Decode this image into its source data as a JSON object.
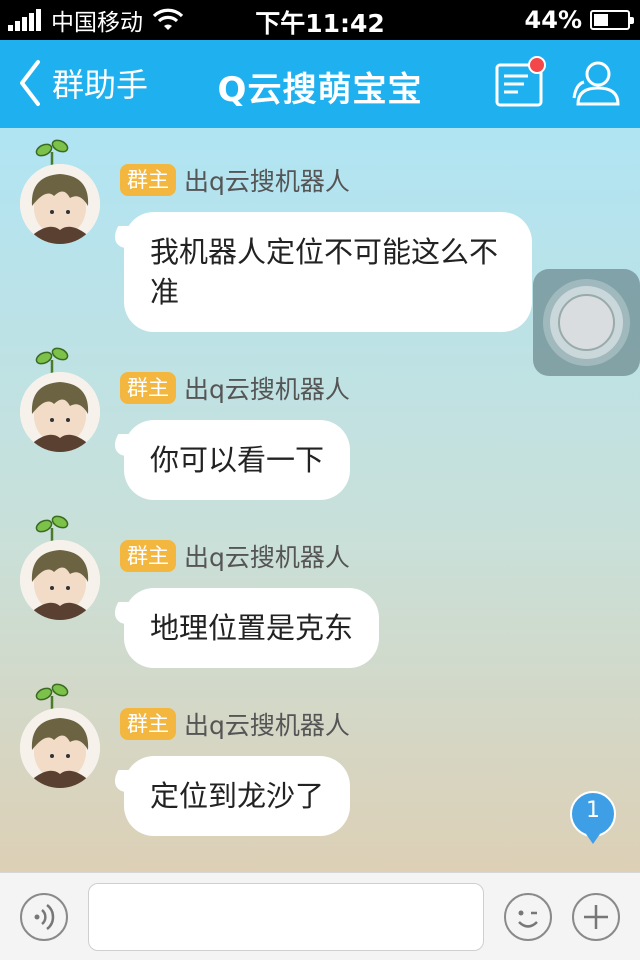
{
  "status_bar": {
    "carrier": "中国移动",
    "time": "下午11:42",
    "battery_text": "44%",
    "battery_level": 0.44,
    "signal_bars": 5
  },
  "nav": {
    "back_label": "群助手",
    "title": "Q云搜萌宝宝",
    "accent_color": "#1fb0ef"
  },
  "messages": [
    {
      "role": "群主",
      "sender": "出q云搜机器人",
      "text": " 我机器人定位不可能这么不准"
    },
    {
      "role": "群主",
      "sender": "出q云搜机器人",
      "text": "你可以看一下"
    },
    {
      "role": "群主",
      "sender": "出q云搜机器人",
      "text": "地理位置是克东"
    },
    {
      "role": "群主",
      "sender": "出q云搜机器人",
      "text": "定位到龙沙了"
    }
  ],
  "unread_badge": "1",
  "input": {
    "value": "",
    "placeholder": ""
  },
  "icons": {
    "back": "chevron-left-icon",
    "message": "message-list-icon",
    "members": "group-members-icon",
    "voice": "voice-icon",
    "emoji": "emoji-icon",
    "plus": "plus-icon",
    "assistive": "assistive-touch-icon"
  }
}
